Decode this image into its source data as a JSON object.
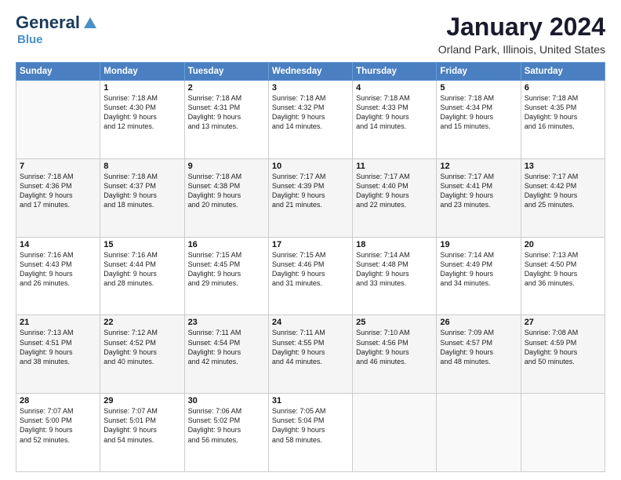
{
  "header": {
    "logo_general": "General",
    "logo_blue": "Blue",
    "title": "January 2024",
    "subtitle": "Orland Park, Illinois, United States"
  },
  "calendar": {
    "days": [
      "Sunday",
      "Monday",
      "Tuesday",
      "Wednesday",
      "Thursday",
      "Friday",
      "Saturday"
    ],
    "weeks": [
      [
        {
          "day": "",
          "info": ""
        },
        {
          "day": "1",
          "info": "Sunrise: 7:18 AM\nSunset: 4:30 PM\nDaylight: 9 hours\nand 12 minutes."
        },
        {
          "day": "2",
          "info": "Sunrise: 7:18 AM\nSunset: 4:31 PM\nDaylight: 9 hours\nand 13 minutes."
        },
        {
          "day": "3",
          "info": "Sunrise: 7:18 AM\nSunset: 4:32 PM\nDaylight: 9 hours\nand 14 minutes."
        },
        {
          "day": "4",
          "info": "Sunrise: 7:18 AM\nSunset: 4:33 PM\nDaylight: 9 hours\nand 14 minutes."
        },
        {
          "day": "5",
          "info": "Sunrise: 7:18 AM\nSunset: 4:34 PM\nDaylight: 9 hours\nand 15 minutes."
        },
        {
          "day": "6",
          "info": "Sunrise: 7:18 AM\nSunset: 4:35 PM\nDaylight: 9 hours\nand 16 minutes."
        }
      ],
      [
        {
          "day": "7",
          "info": "Sunrise: 7:18 AM\nSunset: 4:36 PM\nDaylight: 9 hours\nand 17 minutes."
        },
        {
          "day": "8",
          "info": "Sunrise: 7:18 AM\nSunset: 4:37 PM\nDaylight: 9 hours\nand 18 minutes."
        },
        {
          "day": "9",
          "info": "Sunrise: 7:18 AM\nSunset: 4:38 PM\nDaylight: 9 hours\nand 20 minutes."
        },
        {
          "day": "10",
          "info": "Sunrise: 7:17 AM\nSunset: 4:39 PM\nDaylight: 9 hours\nand 21 minutes."
        },
        {
          "day": "11",
          "info": "Sunrise: 7:17 AM\nSunset: 4:40 PM\nDaylight: 9 hours\nand 22 minutes."
        },
        {
          "day": "12",
          "info": "Sunrise: 7:17 AM\nSunset: 4:41 PM\nDaylight: 9 hours\nand 23 minutes."
        },
        {
          "day": "13",
          "info": "Sunrise: 7:17 AM\nSunset: 4:42 PM\nDaylight: 9 hours\nand 25 minutes."
        }
      ],
      [
        {
          "day": "14",
          "info": "Sunrise: 7:16 AM\nSunset: 4:43 PM\nDaylight: 9 hours\nand 26 minutes."
        },
        {
          "day": "15",
          "info": "Sunrise: 7:16 AM\nSunset: 4:44 PM\nDaylight: 9 hours\nand 28 minutes."
        },
        {
          "day": "16",
          "info": "Sunrise: 7:15 AM\nSunset: 4:45 PM\nDaylight: 9 hours\nand 29 minutes."
        },
        {
          "day": "17",
          "info": "Sunrise: 7:15 AM\nSunset: 4:46 PM\nDaylight: 9 hours\nand 31 minutes."
        },
        {
          "day": "18",
          "info": "Sunrise: 7:14 AM\nSunset: 4:48 PM\nDaylight: 9 hours\nand 33 minutes."
        },
        {
          "day": "19",
          "info": "Sunrise: 7:14 AM\nSunset: 4:49 PM\nDaylight: 9 hours\nand 34 minutes."
        },
        {
          "day": "20",
          "info": "Sunrise: 7:13 AM\nSunset: 4:50 PM\nDaylight: 9 hours\nand 36 minutes."
        }
      ],
      [
        {
          "day": "21",
          "info": "Sunrise: 7:13 AM\nSunset: 4:51 PM\nDaylight: 9 hours\nand 38 minutes."
        },
        {
          "day": "22",
          "info": "Sunrise: 7:12 AM\nSunset: 4:52 PM\nDaylight: 9 hours\nand 40 minutes."
        },
        {
          "day": "23",
          "info": "Sunrise: 7:11 AM\nSunset: 4:54 PM\nDaylight: 9 hours\nand 42 minutes."
        },
        {
          "day": "24",
          "info": "Sunrise: 7:11 AM\nSunset: 4:55 PM\nDaylight: 9 hours\nand 44 minutes."
        },
        {
          "day": "25",
          "info": "Sunrise: 7:10 AM\nSunset: 4:56 PM\nDaylight: 9 hours\nand 46 minutes."
        },
        {
          "day": "26",
          "info": "Sunrise: 7:09 AM\nSunset: 4:57 PM\nDaylight: 9 hours\nand 48 minutes."
        },
        {
          "day": "27",
          "info": "Sunrise: 7:08 AM\nSunset: 4:59 PM\nDaylight: 9 hours\nand 50 minutes."
        }
      ],
      [
        {
          "day": "28",
          "info": "Sunrise: 7:07 AM\nSunset: 5:00 PM\nDaylight: 9 hours\nand 52 minutes."
        },
        {
          "day": "29",
          "info": "Sunrise: 7:07 AM\nSunset: 5:01 PM\nDaylight: 9 hours\nand 54 minutes."
        },
        {
          "day": "30",
          "info": "Sunrise: 7:06 AM\nSunset: 5:02 PM\nDaylight: 9 hours\nand 56 minutes."
        },
        {
          "day": "31",
          "info": "Sunrise: 7:05 AM\nSunset: 5:04 PM\nDaylight: 9 hours\nand 58 minutes."
        },
        {
          "day": "",
          "info": ""
        },
        {
          "day": "",
          "info": ""
        },
        {
          "day": "",
          "info": ""
        }
      ]
    ]
  }
}
